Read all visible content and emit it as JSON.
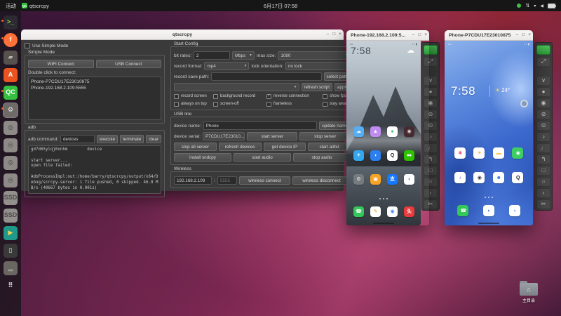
{
  "topbar": {
    "activities": "活动",
    "app_name": "qtscrcpy",
    "clock": "6月17日 07:58",
    "icons": {
      "network": "⇅",
      "chevron": "▾",
      "volume": "◀"
    }
  },
  "window_controls": {
    "minimize": "–",
    "maximize": "□",
    "close": "×"
  },
  "dock": {
    "items": [
      {
        "name": "terminal",
        "glyph": ">_",
        "bg": "#2d2a33",
        "fg": "#8ae234",
        "shape": "22%",
        "dotOpacity": "1",
        "ring": "none"
      },
      {
        "name": "firefox",
        "glyph": "f",
        "bg": "#ff7139",
        "fg": "#fff7e8",
        "shape": "50%",
        "dotOpacity": "1",
        "ring": "none"
      },
      {
        "name": "files",
        "glyph": "▰",
        "bg": "#57514e",
        "fg": "#b9b4b0",
        "shape": "22%",
        "dotOpacity": "0",
        "ring": "none"
      },
      {
        "name": "ubuntu-software",
        "glyph": "A",
        "bg": "#e95420",
        "fg": "#ffffff",
        "shape": "22%",
        "dotOpacity": "0",
        "ring": "none"
      },
      {
        "name": "qtscrcpy",
        "glyph": "QC",
        "bg": "#35c03f",
        "fg": "#ffffff",
        "shape": "22%",
        "dotOpacity": "1",
        "ring": "none"
      },
      {
        "name": "settings",
        "glyph": "⚙",
        "bg": "#6e6a67",
        "fg": "#ecebe9",
        "shape": "22%",
        "dotOpacity": "1",
        "ring": "1px solid rgba(255,255,255,0.45)"
      },
      {
        "name": "disk-1",
        "glyph": "◎",
        "bg": "#8e8a87",
        "fg": "#45423f",
        "shape": "22%",
        "dotOpacity": "0",
        "ring": "none"
      },
      {
        "name": "disk-2",
        "glyph": "◎",
        "bg": "#8e8a87",
        "fg": "#45423f",
        "shape": "22%",
        "dotOpacity": "0",
        "ring": "none"
      },
      {
        "name": "disk-3",
        "glyph": "◎",
        "bg": "#8e8a87",
        "fg": "#45423f",
        "shape": "22%",
        "dotOpacity": "0",
        "ring": "none"
      },
      {
        "name": "disk-4",
        "glyph": "◎",
        "bg": "#8e8a87",
        "fg": "#45423f",
        "shape": "22%",
        "dotOpacity": "0",
        "ring": "none"
      },
      {
        "name": "drive-ssd-1",
        "glyph": "SSD",
        "bg": "#94908d",
        "fg": "#514d4a",
        "shape": "22%",
        "dotOpacity": "0",
        "ring": "none"
      },
      {
        "name": "drive-ssd-2",
        "glyph": "SSD",
        "bg": "#94908d",
        "fg": "#514d4a",
        "shape": "22%",
        "dotOpacity": "0",
        "ring": "none"
      },
      {
        "name": "video-app",
        "glyph": "▶",
        "bg": "#1f9a8a",
        "fg": "#ffd34d",
        "shape": "22%",
        "dotOpacity": "0",
        "ring": "none"
      },
      {
        "name": "phone-mirror",
        "glyph": "▯",
        "bg": "#3a3a3a",
        "fg": "#dddddd",
        "shape": "22%",
        "dotOpacity": "0",
        "ring": "none"
      },
      {
        "name": "minimized-item",
        "glyph": "▂",
        "bg": "#6a6662",
        "fg": "#9a9692",
        "shape": "22%",
        "dotOpacity": "0",
        "ring": "none"
      },
      {
        "name": "app-grid",
        "glyph": "⠿",
        "bg": "transparent",
        "fg": "#dddddd",
        "shape": "0",
        "dotOpacity": "0",
        "ring": "none"
      }
    ]
  },
  "desktop": {
    "home_folder_label": "主目录"
  },
  "main_window": {
    "title": "qtscrcpy",
    "left": {
      "use_simple_mode_label": "Use Simple Mode",
      "simple_mode_group": "Simple Mode",
      "wifi_connect": "WIFI Connect",
      "usb_connect": "USB Connect",
      "double_click_label": "Double click to connect:",
      "devices": [
        "Phone-P7CDU17E23010875",
        "Phone-192.168.2.109:5555"
      ],
      "adb_group": "adb",
      "adb_command_label": "adb command:",
      "adb_command_value": "devices",
      "execute": "execute",
      "terminate": "terminate",
      "clear": "clear",
      "log_text": "gd7d65ylqj6xnhm        device\n\nstart server...\nopen file failed:\n\nAdbProcessImpl:out:/home/barry/qtscrcpy/output/x64/Debug/scrcpy-server: 1 file pushed, 0 skipped. 46.8 MB/s (40667 bytes in 0.001s)"
    },
    "config": {
      "group": "Start Config",
      "bit_rates_label": "bit rates:",
      "bit_rates_value": "2",
      "bit_rates_unit": "Mbps",
      "max_size_label": "max size:",
      "max_size_value": "1080",
      "record_format_label": "record format:",
      "record_format_value": "mp4",
      "lock_orientation_label": "lock orientation:",
      "lock_orientation_value": "no lock",
      "record_save_path_label": "record save path:",
      "record_save_path_value": "",
      "select_path": "select path",
      "script_value": "",
      "refresh_script": "refresh script",
      "apply": "apply",
      "checkboxes": [
        {
          "label": "record screen",
          "mark": ""
        },
        {
          "label": "background record",
          "mark": ""
        },
        {
          "label": "reverse connection",
          "mark": "✓"
        },
        {
          "label": "show fps",
          "mark": ""
        },
        {
          "label": "always on top",
          "mark": ""
        },
        {
          "label": "screen-off",
          "mark": ""
        },
        {
          "label": "frameless",
          "mark": ""
        },
        {
          "label": "stay awake",
          "mark": ""
        }
      ]
    },
    "usb": {
      "group": "USB line",
      "device_name_label": "device name:",
      "device_name_value": "Phone",
      "update_name": "update name",
      "device_serial_label": "device serial:",
      "device_serial_value": "P7CDU17E23010...",
      "start_server": "start server",
      "stop_server": "stop server",
      "row3_buttons": [
        {
          "label": "stop all server"
        },
        {
          "label": "refresh devices"
        },
        {
          "label": "get device IP"
        },
        {
          "label": "start adbd"
        }
      ],
      "row4_buttons": [
        {
          "label": "install sndcpy"
        },
        {
          "label": "start audio"
        },
        {
          "label": "stop audio"
        }
      ]
    },
    "wireless": {
      "group": "Wireless",
      "ip_value": "192.168.2.109",
      "colon": ":",
      "port_placeholder": "5555",
      "connect": "wireless connect",
      "disconnect": "wireless disconnect"
    }
  },
  "phone1": {
    "title": "Phone-192.168.2.109:5...",
    "clock": "7:58",
    "cloud_icon": "☁",
    "icons": [
      {
        "name": "weather-app",
        "glyph": "☁",
        "bg": "#57aef2",
        "fg": "#ffffff"
      },
      {
        "name": "gallery-app",
        "glyph": "▲",
        "bg": "#c18cf0",
        "fg": "#ffffff"
      },
      {
        "name": "green-circle-app",
        "glyph": "●",
        "bg": "#ffffff",
        "fg": "#2fbf5f"
      },
      {
        "name": "camera-app",
        "glyph": "◉",
        "bg": "#452b31",
        "fg": "#e6d6d6"
      },
      {
        "name": "telegram-app",
        "glyph": "✈",
        "bg": "#35a6f0",
        "fg": "#ffffff"
      },
      {
        "name": "browser-whale-app",
        "glyph": "◖",
        "bg": "#2d7ff0",
        "fg": "#ffffff"
      },
      {
        "name": "qq-app",
        "glyph": "Q",
        "bg": "#ffffff",
        "fg": "#1a1a1a"
      },
      {
        "name": "wechat-app",
        "glyph": "●●",
        "bg": "#2dc100",
        "fg": "#ffffff"
      },
      {
        "name": "settings-app",
        "glyph": "⚙",
        "bg": "#767b80",
        "fg": "#eeeeee"
      },
      {
        "name": "orange-store-app",
        "glyph": "▣",
        "bg": "#f7a325",
        "fg": "#ffffff"
      },
      {
        "name": "alipay-app",
        "glyph": "支",
        "bg": "#1677ff",
        "fg": "#ffffff"
      },
      {
        "name": "blue-bird-app",
        "glyph": "◗",
        "bg": "#ffffff",
        "fg": "#1677ff"
      }
    ],
    "dock_icons": [
      {
        "name": "phone-dialer-app",
        "glyph": "☎",
        "bg": "#34c759",
        "fg": "#ffffff"
      },
      {
        "name": "notes-app",
        "glyph": "✎",
        "bg": "#ffffff",
        "fg": "#f59a23"
      },
      {
        "name": "chrome-app",
        "glyph": "◉",
        "bg": "#ffffff",
        "fg": "#4285f4"
      },
      {
        "name": "toutiao-app",
        "glyph": "头",
        "bg": "#e93b3b",
        "fg": "#ffffff"
      }
    ]
  },
  "phone2": {
    "title": "Phone-P7CDU17E23010875",
    "clock": "7:58",
    "sun_icon": "☀",
    "temp": "24°",
    "icons": [
      {
        "name": "gallery-app",
        "glyph": "✱",
        "bg": "#ffffff",
        "fg": "#e85a8a"
      },
      {
        "name": "weather-app",
        "glyph": "☀",
        "bg": "#ffffff",
        "fg": "#f5a623"
      },
      {
        "name": "wallet-app",
        "glyph": "▬",
        "bg": "#ffffff",
        "fg": "#f7c948"
      },
      {
        "name": "health-app",
        "glyph": "◉",
        "bg": "#3ecf63",
        "fg": "#ffffff"
      },
      {
        "name": "music-app",
        "glyph": "♪",
        "bg": "#ffffff",
        "fg": "#8a5ae0"
      },
      {
        "name": "camera-app",
        "glyph": "◉",
        "bg": "#ffffff",
        "fg": "#2f3338"
      },
      {
        "name": "contacts-app",
        "glyph": "☻",
        "bg": "#ffffff",
        "fg": "#3a7bd5"
      },
      {
        "name": "qq-app",
        "glyph": "Q",
        "bg": "#ffffff",
        "fg": "#1a1a1a"
      }
    ],
    "dock_icons": [
      {
        "name": "phone-dialer-app",
        "glyph": "☎",
        "bg": "#34c759",
        "fg": "#ffffff"
      },
      {
        "name": "browser-app",
        "glyph": "◐",
        "bg": "#ffffff",
        "fg": "#2f6fe4"
      },
      {
        "name": "messages-app",
        "glyph": "◗",
        "bg": "#ffffff",
        "fg": "#4a90f0"
      }
    ]
  },
  "phone_toolbar": {
    "fullscreen": {
      "name": "fullscreen-icon",
      "glyph": "⤢"
    },
    "buttons": [
      {
        "name": "collapse-icon",
        "glyph": "∨"
      },
      {
        "name": "touch-icon",
        "glyph": "●"
      },
      {
        "name": "screen-on-icon",
        "glyph": "◉"
      },
      {
        "name": "screen-off-icon",
        "glyph": "⊘"
      },
      {
        "name": "power-icon",
        "glyph": "⊙"
      },
      {
        "name": "volume-up-icon",
        "glyph": "♪"
      },
      {
        "name": "volume-down-icon",
        "glyph": "♩"
      },
      {
        "name": "app-switch-icon",
        "glyph": "↰"
      },
      {
        "name": "menu-icon",
        "glyph": "□"
      },
      {
        "name": "home-icon",
        "glyph": "○"
      },
      {
        "name": "back-icon",
        "glyph": "‹"
      },
      {
        "name": "screenshot-icon",
        "glyph": "✂"
      }
    ]
  }
}
